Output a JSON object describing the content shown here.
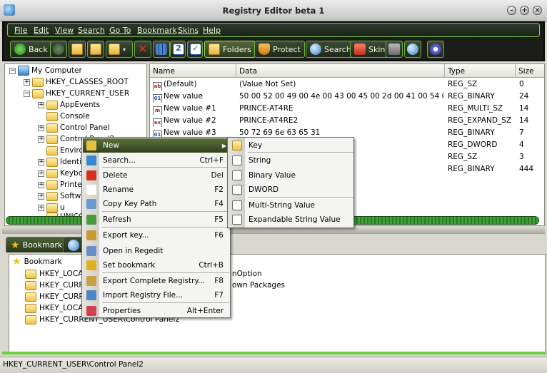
{
  "window": {
    "title": "Registry Editor beta 1"
  },
  "menubar": [
    "File",
    "Edit",
    "View",
    "Search",
    "Go To",
    "Bookmark",
    "Skins",
    "Help"
  ],
  "toolbar": {
    "back": "Back",
    "folders": "Folders",
    "protect": "Protect",
    "search": "Search",
    "skin": "Skin"
  },
  "tree": {
    "root": "My Computer",
    "items": [
      "HKEY_CLASSES_ROOT",
      "HKEY_CURRENT_USER",
      "AppEvents",
      "Console",
      "Control Panel",
      "Control Panel2",
      "Enviro",
      "Identi",
      "Keybo",
      "Printe",
      "Softw",
      "u",
      "UNICO"
    ]
  },
  "list": {
    "columns": [
      "Name",
      "Data",
      "Type",
      "Size"
    ],
    "rows": [
      {
        "icon": "ab",
        "name": "(Default)",
        "data": "(Value Not Set)",
        "type": "REG_SZ",
        "size": "0"
      },
      {
        "icon": "bin",
        "name": "New value",
        "data": "50 00 52 00 49 00 4e 00 43 00 45 00 2d 00 41 00 54 0...",
        "type": "REG_BINARY",
        "size": "24"
      },
      {
        "icon": "m",
        "name": "New value #1",
        "data": "PRINCE-AT4RE",
        "type": "REG_MULTI_SZ",
        "size": "14"
      },
      {
        "icon": "ex",
        "name": "New value #2",
        "data": "PRINCE-AT4RE2",
        "type": "REG_EXPAND_SZ",
        "size": "14"
      },
      {
        "icon": "bin",
        "name": "New value #3",
        "data": "50 72 69 6e 63 65 31",
        "type": "REG_BINARY",
        "size": "7"
      },
      {
        "icon": "bin",
        "name": "",
        "data": "",
        "type": "REG_DWORD",
        "size": "4"
      },
      {
        "icon": "ab",
        "name": "",
        "data": "",
        "type": "REG_SZ",
        "size": "3"
      },
      {
        "icon": "bin",
        "name": "",
        "data": "1 00 bc 00 00 00 0c 0...",
        "type": "REG_BINARY",
        "size": "444"
      }
    ]
  },
  "bookmarks": {
    "tab_bookmark": "Bookmark",
    "tab_second": "S",
    "root": "Bookmark",
    "items": [
      "HKEY_LOCAL",
      "HKEY_CURR",
      "HKEY_CURR",
      "HKEY_LOCAL",
      "HKEY_CURRENT_USER\\Control Panel2"
    ],
    "right_texts": [
      "nOption",
      "own Packages"
    ]
  },
  "context_menu": [
    {
      "label": "New",
      "shortcut": "",
      "sub": true
    },
    {
      "label": "Search...",
      "shortcut": "Ctrl+F"
    },
    {
      "label": "Delete",
      "shortcut": "Del"
    },
    {
      "label": "Rename",
      "shortcut": "F2"
    },
    {
      "label": "Copy Key Path",
      "shortcut": "F4"
    },
    {
      "label": "Refresh",
      "shortcut": "F5"
    },
    {
      "label": "Export key...",
      "shortcut": "F6"
    },
    {
      "label": "Open in Regedit",
      "shortcut": ""
    },
    {
      "label": "Set bookmark",
      "shortcut": "Ctrl+B"
    },
    {
      "label": "Export Complete Registry...",
      "shortcut": "F8"
    },
    {
      "label": "Import Registry File...",
      "shortcut": "F7"
    },
    {
      "label": "Properties",
      "shortcut": "Alt+Enter"
    }
  ],
  "submenu": [
    "Key",
    "String",
    "Binary Value",
    "DWORD",
    "Multi-String Value",
    "Expandable String Value"
  ],
  "status": "HKEY_CURRENT_USER\\Control Panel2"
}
